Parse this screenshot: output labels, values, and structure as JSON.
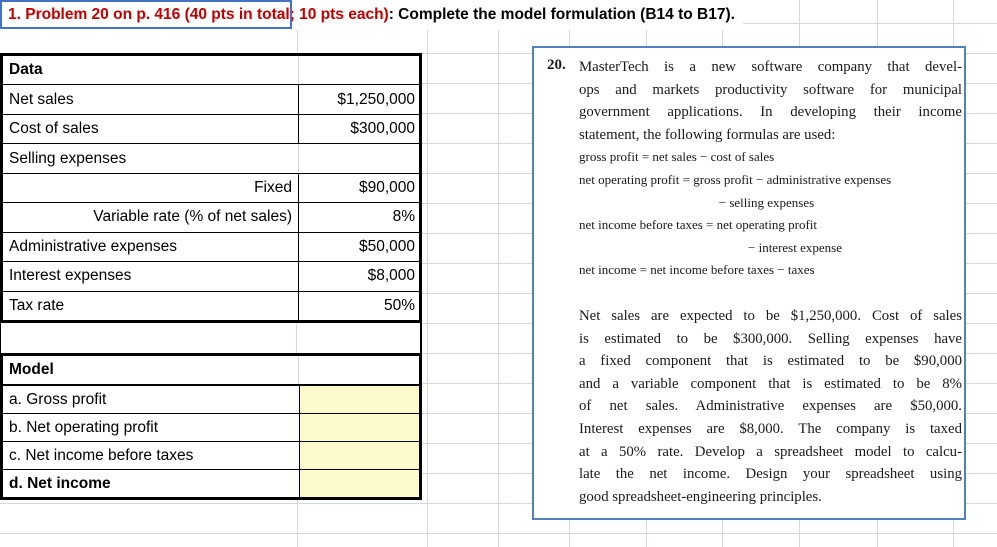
{
  "title": {
    "red": "1. Problem 20 on p. 416 (40 pts in total; 10 pts each)",
    "black": ": Complete the model formulation (B14 to B17)."
  },
  "data_table": {
    "header": "Data",
    "rows": [
      {
        "label": "Net sales",
        "value": "$1,250,000"
      },
      {
        "label": "Cost of sales",
        "value": "$300,000"
      },
      {
        "label": "Selling expenses",
        "value": ""
      },
      {
        "label": "Fixed",
        "value": "$90,000"
      },
      {
        "label": "Variable rate (% of net sales)",
        "value": "8%"
      },
      {
        "label": "Administrative expenses",
        "value": "$50,000"
      },
      {
        "label": "Interest expenses",
        "value": "$8,000"
      },
      {
        "label": "Tax rate",
        "value": "50%"
      }
    ]
  },
  "model_table": {
    "header": "Model",
    "rows": [
      {
        "label": "a. Gross profit"
      },
      {
        "label": "b. Net operating profit"
      },
      {
        "label": "c. Net income before taxes"
      },
      {
        "label": "d. Net income"
      }
    ]
  },
  "problem_box": {
    "number": "20.",
    "intro_lines": [
      "MasterTech is a new software company that devel-",
      "ops and markets productivity software for municipal",
      "government applications. In developing their income",
      "statement, the following formulas are used:"
    ],
    "formula_lines": [
      "gross profit = net sales − cost of sales",
      "net operating profit = gross profit − administrative expenses",
      "                                           − selling expenses",
      "net income before taxes = net operating profit",
      "                                                    − interest expense",
      "net income = net income before taxes − taxes"
    ],
    "body_lines": [
      "Net sales are expected to be $1,250,000. Cost of sales",
      "is estimated to be $300,000. Selling expenses have",
      "a fixed component that is estimated to be $90,000",
      "and a variable component that is estimated to be 8%",
      "of net sales. Administrative expenses are $50,000.",
      "Interest expenses are $8,000. The company is taxed",
      "at a 50% rate. Develop a spreadsheet model to calcu-",
      "late the net income. Design your spreadsheet using",
      "good spreadsheet-engineering principles."
    ]
  },
  "colors": {
    "title_red": "#C00000",
    "box_border_blue": "#4F81BD",
    "selection_blue": "#4472C4",
    "input_cell_yellow": "#FCF9CD",
    "gridline_gray": "#D4D7DC"
  }
}
